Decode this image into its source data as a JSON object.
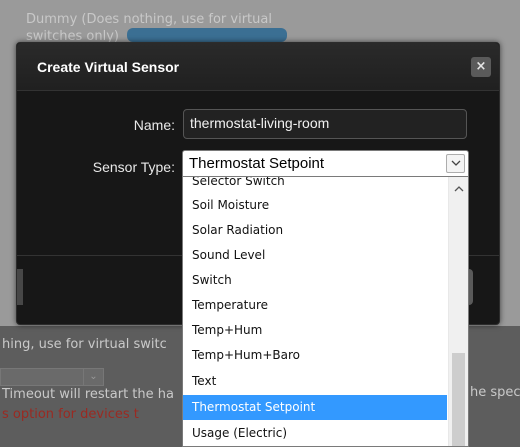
{
  "background": {
    "top_text_line1": "Dummy (Does nothing, use for virtual",
    "top_text_line2": "switches only)",
    "line_use_for_virtual": "hing, use for virtual switc",
    "line_timeout": "Timeout will restart the ha",
    "line_option": "s option for devices t",
    "right_text": "he spec"
  },
  "dialog": {
    "title": "Create Virtual Sensor",
    "close_label": "×",
    "name_label": "Name:",
    "name_value": "thermostat-living-room",
    "sensor_type_label": "Sensor Type:",
    "sensor_type_selected": "Thermostat Setpoint"
  },
  "dropdown": {
    "options": [
      {
        "label": "Selector Switch",
        "selected": false,
        "partial": true
      },
      {
        "label": "Soil Moisture",
        "selected": false
      },
      {
        "label": "Solar Radiation",
        "selected": false
      },
      {
        "label": "Sound Level",
        "selected": false
      },
      {
        "label": "Switch",
        "selected": false
      },
      {
        "label": "Temperature",
        "selected": false
      },
      {
        "label": "Temp+Hum",
        "selected": false
      },
      {
        "label": "Temp+Hum+Baro",
        "selected": false
      },
      {
        "label": "Text",
        "selected": false
      },
      {
        "label": "Thermostat Setpoint",
        "selected": true
      },
      {
        "label": "Usage (Electric)",
        "selected": false
      }
    ]
  },
  "colors": {
    "selection": "#3399ff",
    "dialog_bg": "#171717",
    "overlay_red_text": "#9a2a22"
  },
  "icons": {
    "close": "close-icon",
    "select_arrow": "chevron-down-icon",
    "scroll_up": "chevron-up-icon"
  }
}
